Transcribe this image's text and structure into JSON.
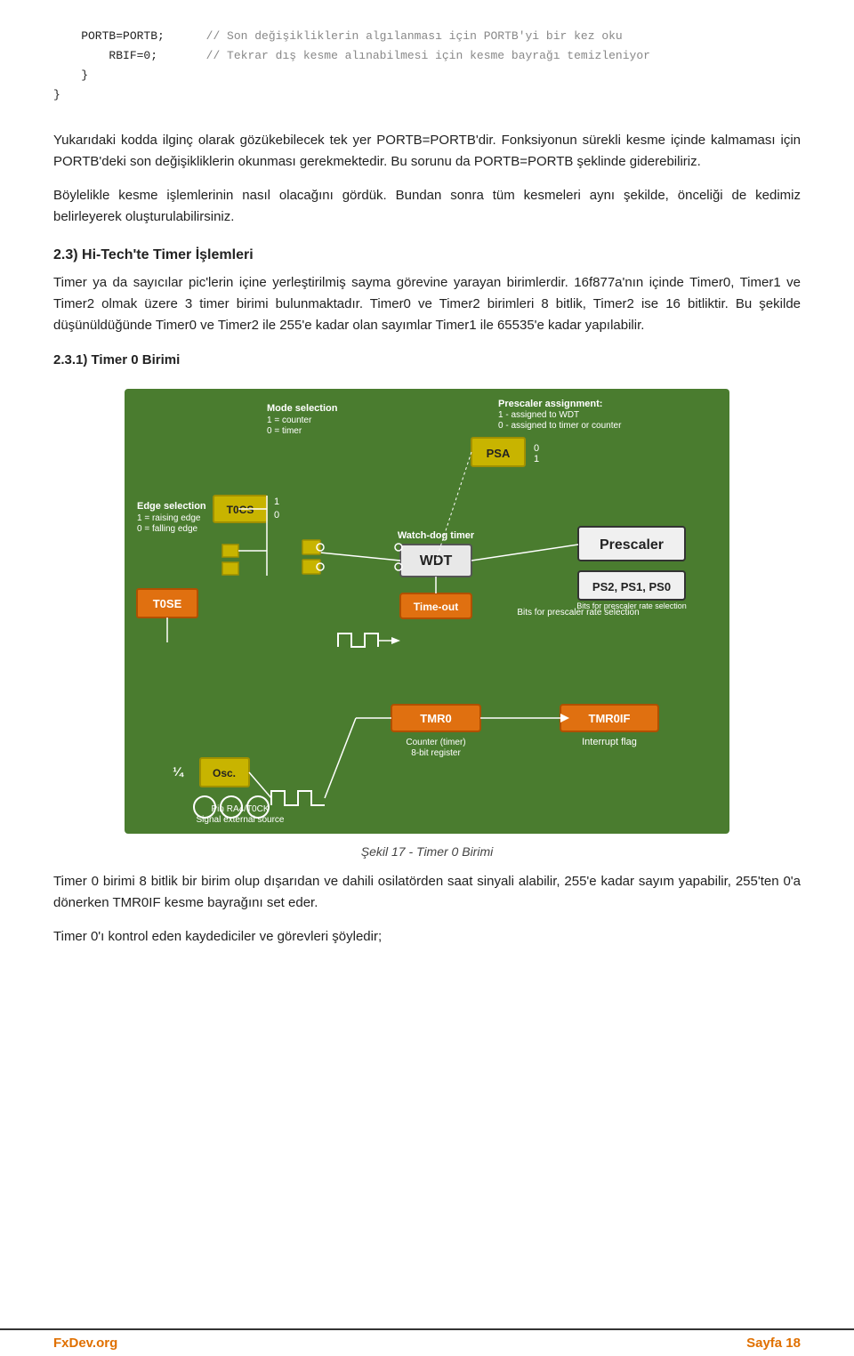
{
  "code": {
    "lines": [
      {
        "indent": "        ",
        "code": "PORTB=PORTB;",
        "comment": "        // Son değişikliklerin algılanması için PORTB'yi bir kez oku"
      },
      {
        "indent": "        ",
        "code": "RBIF=0;",
        "comment": "     // Tekrar dış kesme alınabilmesi için kesme bayrağı temizleniyor"
      },
      {
        "indent": "        ",
        "code": "}"
      },
      {
        "indent": "}",
        "code": ""
      }
    ]
  },
  "paragraphs": {
    "p1": "Yukarıdaki kodda ilginç olarak gözükebilecek tek yer PORTB=PORTB'dir. Fonksiyonun sürekli kesme içinde kalmaması için PORTB'deki son değişikliklerin okunması gerekmektedir. Bu sorunu da PORTB=PORTB şeklinde giderebiliriz.",
    "p2": "Böylelikle kesme işlemlerinin nasıl olacağını gördük. Bundan sonra tüm kesmeleri aynı şekilde, önceliği de kedimiz belirleyerek oluşturulabilirsiniz.",
    "heading1": "2.3) Hi-Tech'te Timer İşlemleri",
    "p3": "Timer ya da sayıcılar pic'lerin içine yerleştirilmiş sayma görevine yarayan birimlerdir. 16f877a'nın içinde Timer0, Timer1 ve Timer2 olmak üzere 3 timer birimi bulunmaktadır. Timer0 ve Timer2 birimleri 8 bitlik, Timer2 ise 16 bitliktir. Bu şekilde düşünüldüğünde Timer0 ve Timer2 ile 255'e kadar olan sayımlar Timer1 ile 65535'e kadar yapılabilir.",
    "heading2": "2.3.1) Timer 0 Birimi",
    "caption": "Şekil 17 - Timer 0 Birimi",
    "p4": "Timer 0 birimi 8 bitlik bir birim olup dışarıdan ve dahili osilatörden saat sinyali alabilir, 255'e kadar sayım yapabilir, 255'ten 0'a dönerken TMR0IF kesme bayrağını set eder.",
    "p5": "Timer 0'ı kontrol eden kaydediciler ve görevleri şöyledir;"
  },
  "footer": {
    "left": "FxDev.org",
    "right": "Sayfa 18"
  }
}
